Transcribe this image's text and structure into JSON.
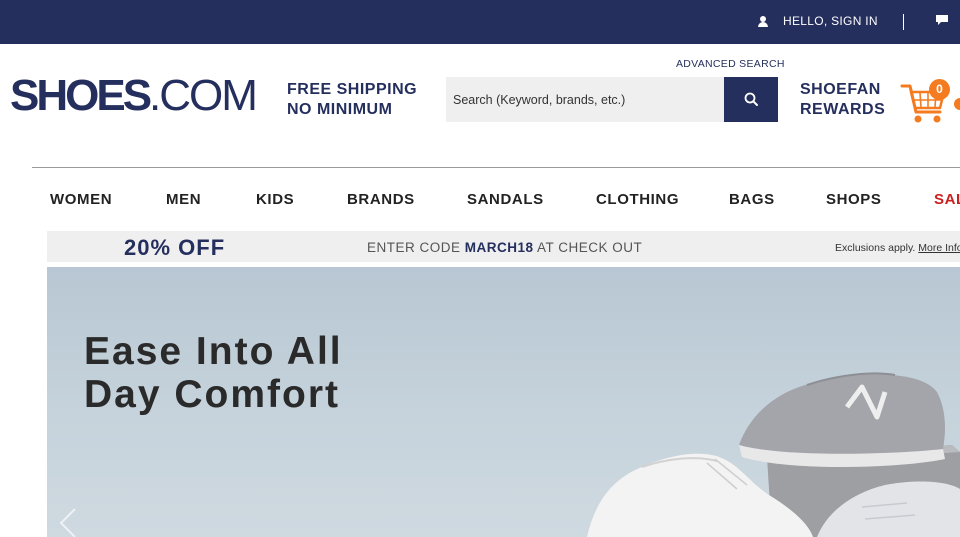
{
  "topbar": {
    "signin_label": "HELLO, SIGN IN",
    "user_icon": "user-icon",
    "chat_icon": "chat-bubble-icon"
  },
  "header": {
    "logo_bold": "SHOES",
    "logo_light": ".COM",
    "free_shipping_line1": "FREE SHIPPING",
    "free_shipping_line2": "NO MINIMUM",
    "advanced_search": "ADVANCED SEARCH",
    "search_placeholder": "Search (Keyword, brands, etc.)",
    "search_icon": "search-icon",
    "rewards_line1": "SHOEFAN",
    "rewards_line2": "REWARDS",
    "cart_icon": "cart-icon",
    "cart_count": "0"
  },
  "nav": {
    "items": [
      {
        "label": "WOMEN"
      },
      {
        "label": "MEN"
      },
      {
        "label": "KIDS"
      },
      {
        "label": "BRANDS"
      },
      {
        "label": "SANDALS"
      },
      {
        "label": "CLOTHING"
      },
      {
        "label": "BAGS"
      },
      {
        "label": "SHOPS"
      },
      {
        "label": "SAL"
      }
    ]
  },
  "promo": {
    "discount": "20% OFF",
    "code_prefix": "ENTER CODE ",
    "code": "MARCH18",
    "code_suffix": " AT CHECK OUT",
    "exclusions": "Exclusions apply.",
    "more_info": "More Info"
  },
  "hero": {
    "title_line1": "Ease Into All",
    "title_line2": "Day Comfort",
    "prev_icon": "chevron-left-icon"
  },
  "colors": {
    "brand_navy": "#252f5e",
    "cart_orange": "#f47b20",
    "sale_red": "#cc1f1f"
  }
}
